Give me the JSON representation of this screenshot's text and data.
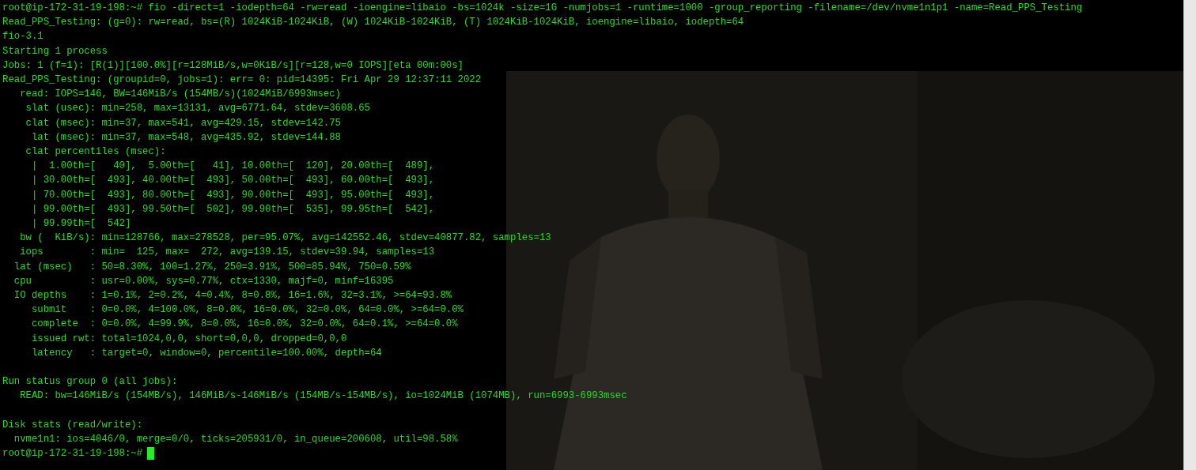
{
  "terminal": {
    "blocks": [
      [
        "root@ip-172-31-19-198:~# fio -direct=1 -iodepth=64 -rw=read -ioengine=libaio -bs=1024k -size=1G -numjobs=1 -runtime=1000 -group_reporting -filename=/dev/nvme1n1p1 -name=Read_PPS_Testing",
        "Read_PPS_Testing: (g=0): rw=read, bs=(R) 1024KiB-1024KiB, (W) 1024KiB-1024KiB, (T) 1024KiB-1024KiB, ioengine=libaio, iodepth=64",
        "fio-3.1",
        "Starting 1 process",
        "Jobs: 1 (f=1): [R(1)][100.0%][r=128MiB/s,w=0KiB/s][r=128,w=0 IOPS][eta 00m:00s]",
        "Read_PPS_Testing: (groupid=0, jobs=1): err= 0: pid=14395: Fri Apr 29 12:37:11 2022",
        "   read: IOPS=146, BW=146MiB/s (154MB/s)(1024MiB/6993msec)",
        "    slat (usec): min=258, max=13131, avg=6771.64, stdev=3608.65",
        "    clat (msec): min=37, max=541, avg=429.15, stdev=142.75",
        "     lat (msec): min=37, max=548, avg=435.92, stdev=144.88",
        "    clat percentiles (msec):",
        "     |  1.00th=[   40],  5.00th=[   41], 10.00th=[  120], 20.00th=[  489],",
        "     | 30.00th=[  493], 40.00th=[  493], 50.00th=[  493], 60.00th=[  493],",
        "     | 70.00th=[  493], 80.00th=[  493], 90.00th=[  493], 95.00th=[  493],",
        "     | 99.00th=[  493], 99.50th=[  502], 99.90th=[  535], 99.95th=[  542],",
        "     | 99.99th=[  542]",
        "   bw (  KiB/s): min=128766, max=278528, per=95.07%, avg=142552.46, stdev=40877.82, samples=13",
        "   iops        : min=  125, max=  272, avg=139.15, stdev=39.94, samples=13",
        "  lat (msec)   : 50=8.30%, 100=1.27%, 250=3.91%, 500=85.94%, 750=0.59%",
        "  cpu          : usr=0.00%, sys=0.77%, ctx=1330, majf=0, minf=16395",
        "  IO depths    : 1=0.1%, 2=0.2%, 4=0.4%, 8=0.8%, 16=1.6%, 32=3.1%, >=64=93.8%",
        "     submit    : 0=0.0%, 4=100.0%, 8=0.0%, 16=0.0%, 32=0.0%, 64=0.0%, >=64=0.0%",
        "     complete  : 0=0.0%, 4=99.9%, 8=0.0%, 16=0.0%, 32=0.0%, 64=0.1%, >=64=0.0%",
        "     issued rwt: total=1024,0,0, short=0,0,0, dropped=0,0,0",
        "     latency   : target=0, window=0, percentile=100.00%, depth=64"
      ],
      [
        "Run status group 0 (all jobs):",
        "   READ: bw=146MiB/s (154MB/s), 146MiB/s-146MiB/s (154MB/s-154MB/s), io=1024MiB (1074MB), run=6993-6993msec"
      ],
      [
        "Disk stats (read/write):",
        "  nvme1n1: ios=4046/0, merge=0/0, ticks=205931/0, in_queue=200608, util=98.58%"
      ]
    ],
    "prompt": "root@ip-172-31-19-198:~#"
  }
}
